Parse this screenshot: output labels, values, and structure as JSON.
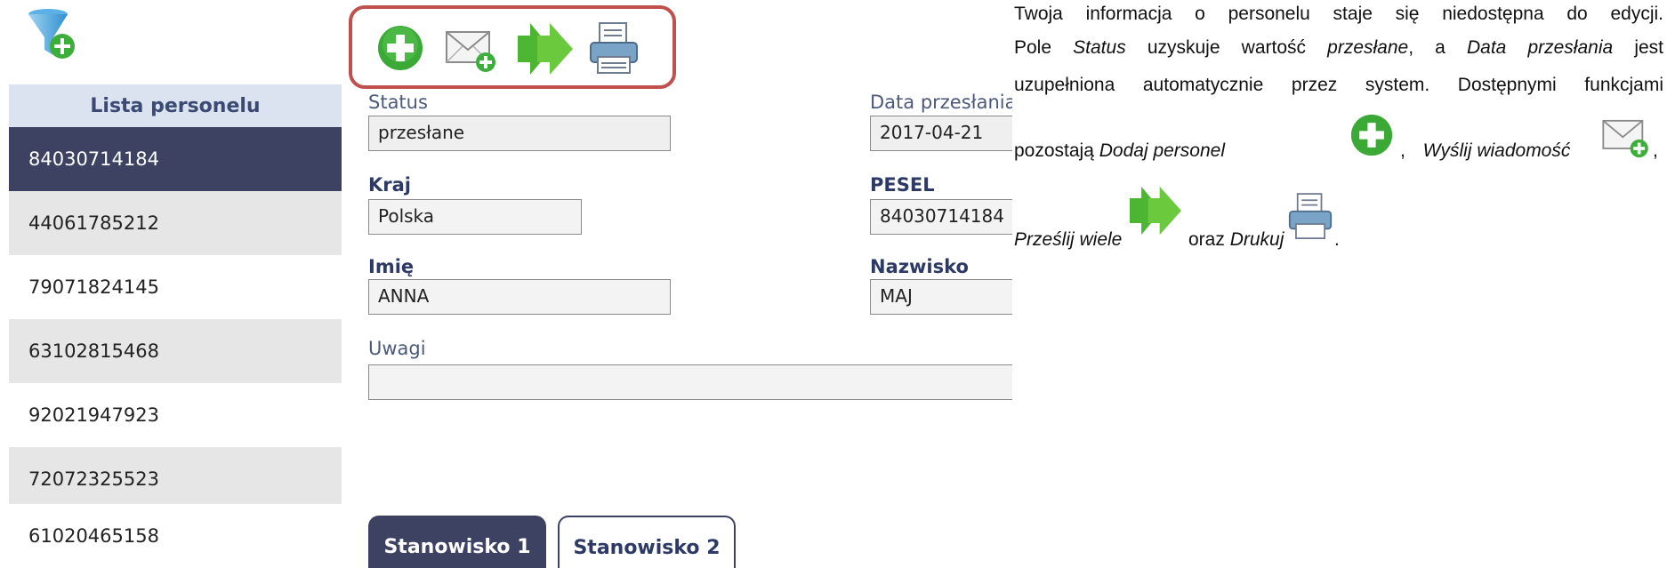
{
  "sidebar": {
    "header": "Lista personelu",
    "items": [
      {
        "label": "84030714184"
      },
      {
        "label": "44061785212"
      },
      {
        "label": "79071824145"
      },
      {
        "label": "63102815468"
      },
      {
        "label": "92021947923"
      },
      {
        "label": "72072325523"
      },
      {
        "label": "61020465158"
      }
    ]
  },
  "toolbar": {
    "icons": [
      "plus-circle-icon",
      "envelope-plus-icon",
      "double-arrow-icon",
      "printer-icon"
    ]
  },
  "form": {
    "status_label": "Status",
    "status_value": "przesłane",
    "date_label": "Data przesłania",
    "date_value": "2017-04-21",
    "country_label": "Kraj",
    "country_value": "Polska",
    "pesel_label": "PESEL",
    "pesel_value": "84030714184",
    "name_label": "Imię",
    "name_value": "ANNA",
    "surname_label": "Nazwisko",
    "surname_value": "MAJ",
    "notes_label": "Uwagi",
    "notes_value": ""
  },
  "tabs": [
    {
      "label": "Stanowisko 1"
    },
    {
      "label": "Stanowisko 2"
    }
  ],
  "description": {
    "l1": "Twoja informacja o personelu staje się niedostępna do edycji.",
    "l2a": "Pole ",
    "l2b": "Status",
    "l2c": " uzyskuje wartość ",
    "l2d": "przesłane",
    "l2e": ", a ",
    "l2f": "Data przesłania",
    "l2g": " jest",
    "l3": "uzupełniona automatycznie przez system. Dostępnymi funkcjami",
    "l4a": "pozostają ",
    "l4b": "Dodaj personel",
    "l4c": ", ",
    "l4d": "Wyślij wiadomość",
    "l4e": ",",
    "l5a": "Prześlij wiele",
    "l5b": "oraz ",
    "l5c": "Drukuj",
    "l5d": "."
  }
}
